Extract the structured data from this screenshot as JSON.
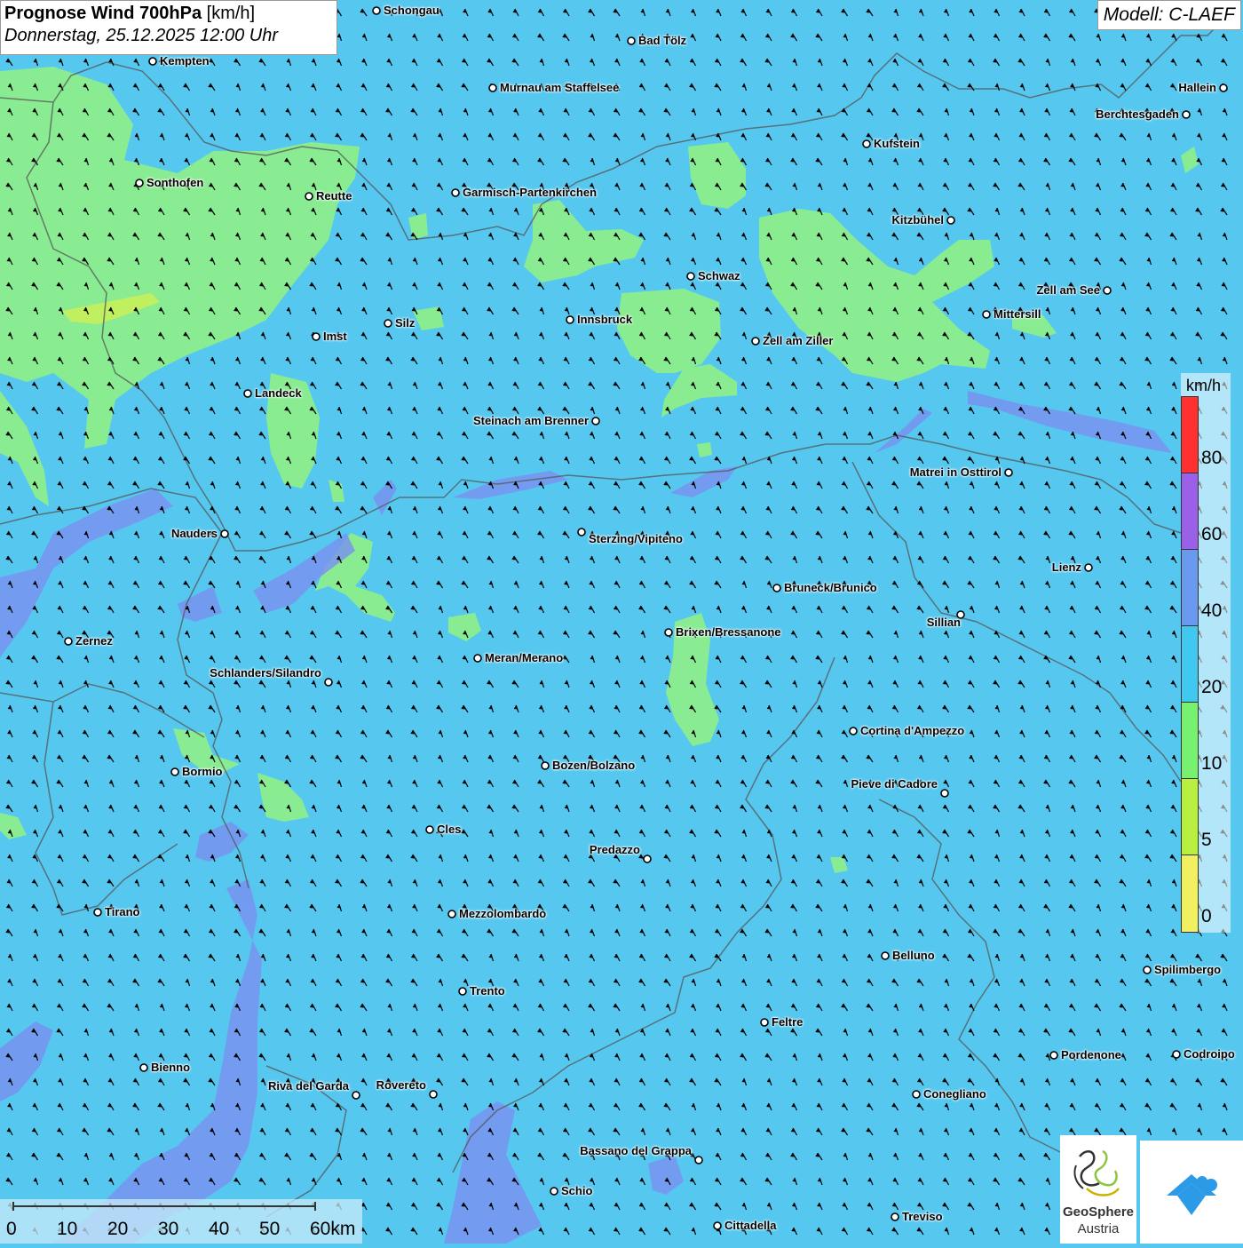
{
  "title": {
    "main": "Prognose Wind 700hPa",
    "unit": "[km/h]",
    "datetime": "Donnerstag, 25.12.2025 12:00 Uhr"
  },
  "model": "Modell: C-LAEF",
  "legend": {
    "unit": "km/h",
    "ticks": [
      "80",
      "60",
      "40",
      "20",
      "10",
      "5",
      "0"
    ],
    "colors": [
      "#ff3030",
      "#9a60e8",
      "#6a9af0",
      "#40c8f0",
      "#78f070",
      "#b8f040",
      "#f0f060"
    ]
  },
  "scale": {
    "labels": [
      "0",
      "10",
      "20",
      "30",
      "40",
      "50",
      "60km"
    ]
  },
  "logo": {
    "name_line1": "GeoSphere",
    "name_line2": "Austria",
    "icon": "geosphere-logo-icon",
    "app_icon": "weather-app-icon"
  },
  "colors": {
    "background_wind_20_40": "#56c8f0",
    "wind_10_20": "#8cee8c",
    "wind_40_60": "#7a90f0",
    "wind_5_10": "#c0f060",
    "arrow": "#000000",
    "border": "#555555"
  },
  "wind_arrows": {
    "prevailing_direction": "towards north-north-west",
    "icon": "wind-arrow-icon"
  },
  "cities": [
    {
      "name": "Schongau"
    },
    {
      "name": "Bad Tölz"
    },
    {
      "name": "Kempten"
    },
    {
      "name": "Murnau am Staffelsee"
    },
    {
      "name": "Hallein"
    },
    {
      "name": "Berchtesgaden"
    },
    {
      "name": "Kufstein"
    },
    {
      "name": "Sonthofen"
    },
    {
      "name": "Reutte"
    },
    {
      "name": "Garmisch-Partenkirchen"
    },
    {
      "name": "Kitzbühel"
    },
    {
      "name": "Schwaz"
    },
    {
      "name": "Zell am See"
    },
    {
      "name": "Mittersill"
    },
    {
      "name": "Silz"
    },
    {
      "name": "Innsbruck"
    },
    {
      "name": "Imst"
    },
    {
      "name": "Zell am Ziller"
    },
    {
      "name": "Landeck"
    },
    {
      "name": "Steinach am Brenner"
    },
    {
      "name": "Matrei in Osttirol"
    },
    {
      "name": "Nauders"
    },
    {
      "name": "Sterzing/Vipiteno"
    },
    {
      "name": "Lienz"
    },
    {
      "name": "Bruneck/Brunico"
    },
    {
      "name": "Sillian"
    },
    {
      "name": "Brixen/Bressanone"
    },
    {
      "name": "Zernez"
    },
    {
      "name": "Meran/Merano"
    },
    {
      "name": "Schlanders/Silandro"
    },
    {
      "name": "Cortina d'Ampezzo"
    },
    {
      "name": "Bozen/Bolzano"
    },
    {
      "name": "Bormio"
    },
    {
      "name": "Pieve di Cadore"
    },
    {
      "name": "Cles"
    },
    {
      "name": "Predazzo"
    },
    {
      "name": "Tirano"
    },
    {
      "name": "Mezzolombardo"
    },
    {
      "name": "Belluno"
    },
    {
      "name": "Spilimbergo"
    },
    {
      "name": "Trento"
    },
    {
      "name": "Feltre"
    },
    {
      "name": "Pordenone"
    },
    {
      "name": "Codroipo"
    },
    {
      "name": "Bienno"
    },
    {
      "name": "Riva del Garda"
    },
    {
      "name": "Rovereto"
    },
    {
      "name": "Conegliano"
    },
    {
      "name": "Bassano del Grappa"
    },
    {
      "name": "Schio"
    },
    {
      "name": "Treviso"
    },
    {
      "name": "Cittadella"
    }
  ]
}
